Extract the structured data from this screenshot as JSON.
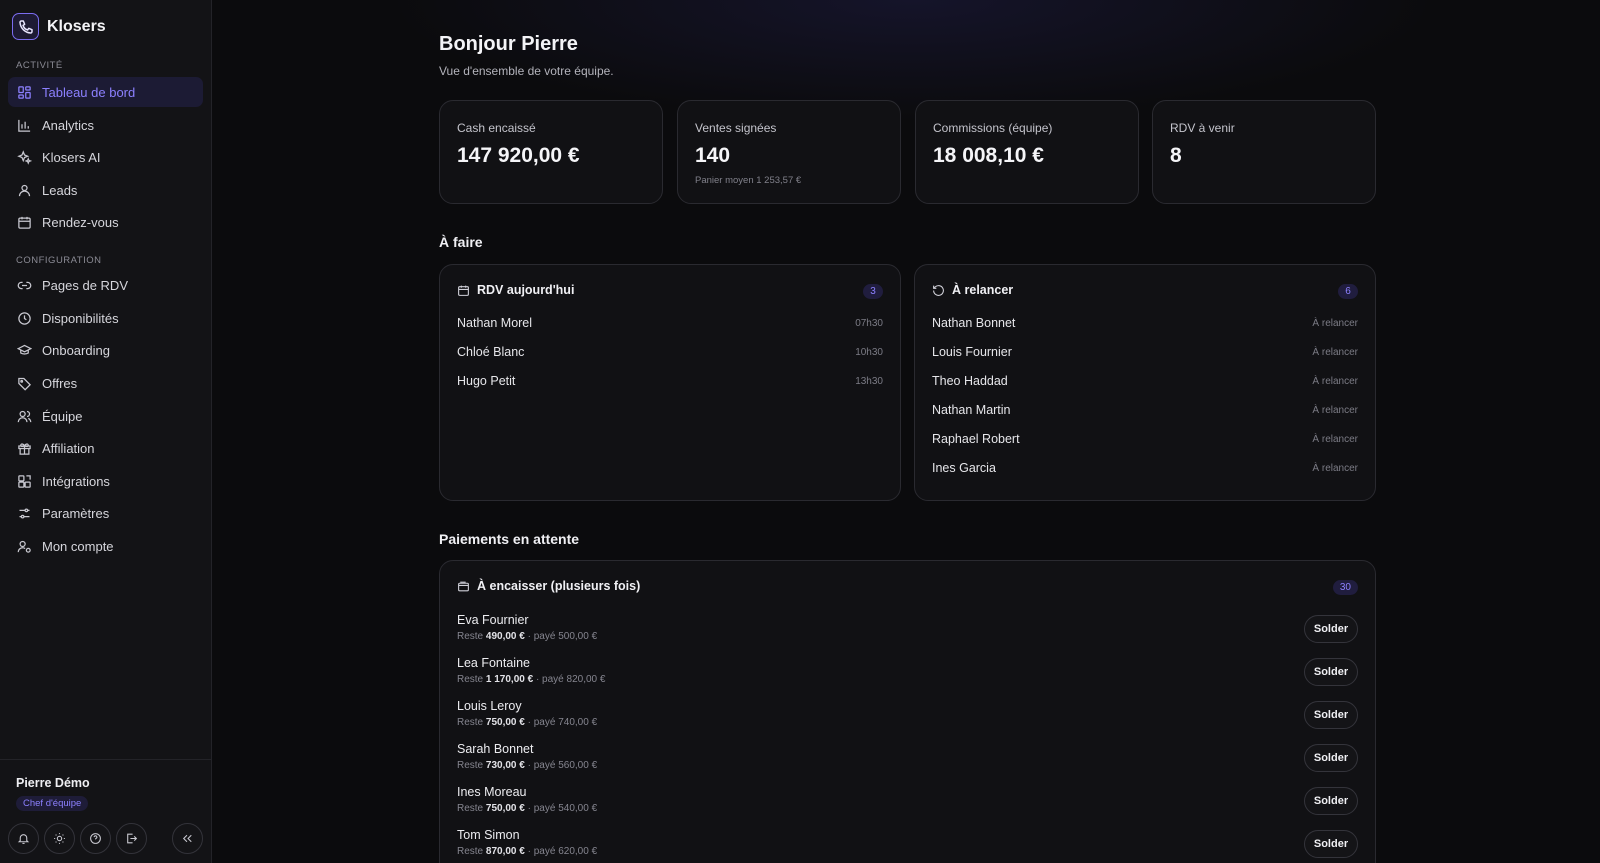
{
  "brand": {
    "name": "Klosers"
  },
  "sidebar": {
    "section_activity": "ACTIVITÉ",
    "section_config": "CONFIGURATION",
    "activity_items": [
      {
        "label": "Tableau de bord",
        "icon": "dashboard-icon",
        "active": true
      },
      {
        "label": "Analytics",
        "icon": "bar-chart-icon"
      },
      {
        "label": "Klosers AI",
        "icon": "sparkles-icon"
      },
      {
        "label": "Leads",
        "icon": "user-icon"
      },
      {
        "label": "Rendez-vous",
        "icon": "calendar-icon"
      }
    ],
    "config_items": [
      {
        "label": "Pages de RDV",
        "icon": "link-icon"
      },
      {
        "label": "Disponibilités",
        "icon": "clock-icon"
      },
      {
        "label": "Onboarding",
        "icon": "graduation-cap-icon"
      },
      {
        "label": "Offres",
        "icon": "tag-icon"
      },
      {
        "label": "Équipe",
        "icon": "users-icon"
      },
      {
        "label": "Affiliation",
        "icon": "gift-icon"
      },
      {
        "label": "Intégrations",
        "icon": "puzzle-icon"
      },
      {
        "label": "Paramètres",
        "icon": "sliders-icon"
      },
      {
        "label": "Mon compte",
        "icon": "user-gear-icon"
      }
    ],
    "user": {
      "name": "Pierre Démo",
      "role": "Chef d'équipe"
    }
  },
  "header": {
    "greeting": "Bonjour Pierre",
    "subtitle": "Vue d'ensemble de votre équipe."
  },
  "kpis": [
    {
      "label": "Cash encaissé",
      "value": "147 920,00 €",
      "sub": ""
    },
    {
      "label": "Ventes signées",
      "value": "140",
      "sub": "Panier moyen 1 253,57 €"
    },
    {
      "label": "Commissions (équipe)",
      "value": "18 008,10 €",
      "sub": ""
    },
    {
      "label": "RDV à venir",
      "value": "8",
      "sub": ""
    }
  ],
  "todo": {
    "title": "À faire",
    "today": {
      "title": "RDV aujourd'hui",
      "count": "3",
      "items": [
        {
          "name": "Nathan Morel",
          "time": "07h30"
        },
        {
          "name": "Chloé Blanc",
          "time": "10h30"
        },
        {
          "name": "Hugo Petit",
          "time": "13h30"
        }
      ]
    },
    "followup": {
      "title": "À relancer",
      "count": "6",
      "items": [
        {
          "name": "Nathan Bonnet",
          "status": "À relancer"
        },
        {
          "name": "Louis Fournier",
          "status": "À relancer"
        },
        {
          "name": "Theo Haddad",
          "status": "À relancer"
        },
        {
          "name": "Nathan Martin",
          "status": "À relancer"
        },
        {
          "name": "Raphael Robert",
          "status": "À relancer"
        },
        {
          "name": "Ines Garcia",
          "status": "À relancer"
        }
      ]
    }
  },
  "payments": {
    "title": "Paiements en attente",
    "card_title": "À encaisser (plusieurs fois)",
    "count": "30",
    "rest_label": "Reste",
    "paid_label": "· payé",
    "button_label": "Solder",
    "items": [
      {
        "name": "Eva Fournier",
        "rest": "490,00 €",
        "paid": "500,00 €"
      },
      {
        "name": "Lea Fontaine",
        "rest": "1 170,00 €",
        "paid": "820,00 €"
      },
      {
        "name": "Louis Leroy",
        "rest": "750,00 €",
        "paid": "740,00 €"
      },
      {
        "name": "Sarah Bonnet",
        "rest": "730,00 €",
        "paid": "560,00 €"
      },
      {
        "name": "Ines Moreau",
        "rest": "750,00 €",
        "paid": "540,00 €"
      },
      {
        "name": "Tom Simon",
        "rest": "870,00 €",
        "paid": "620,00 €"
      }
    ]
  },
  "colors": {
    "accent": "#8c80ff",
    "background": "#0b0b0d",
    "card": "#111114"
  }
}
